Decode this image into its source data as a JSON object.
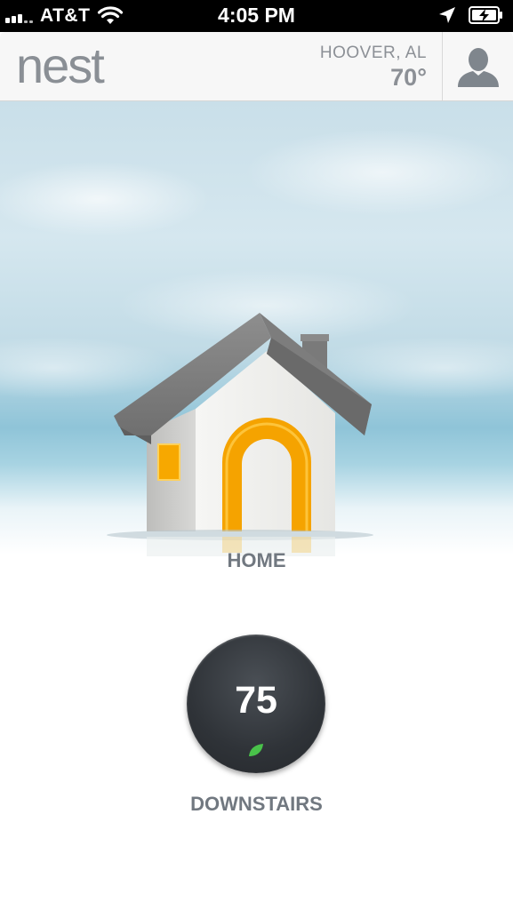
{
  "status_bar": {
    "carrier": "AT&T",
    "time": "4:05 PM",
    "signal_icon": "signal-bars-icon",
    "wifi_icon": "wifi-icon",
    "location_icon": "location-arrow-icon",
    "battery_icon": "battery-charging-icon"
  },
  "header": {
    "logo": "nest",
    "location": "HOOVER, AL",
    "temperature": "70°",
    "profile_icon": "user-profile-icon"
  },
  "structure": {
    "name": "HOME",
    "illustration": "house-icon",
    "accent_color": "#f5a300"
  },
  "thermostats": [
    {
      "target_temperature": "75",
      "name": "DOWNSTAIRS",
      "leaf_icon": "leaf-icon",
      "leaf_color": "#49c24a"
    }
  ]
}
